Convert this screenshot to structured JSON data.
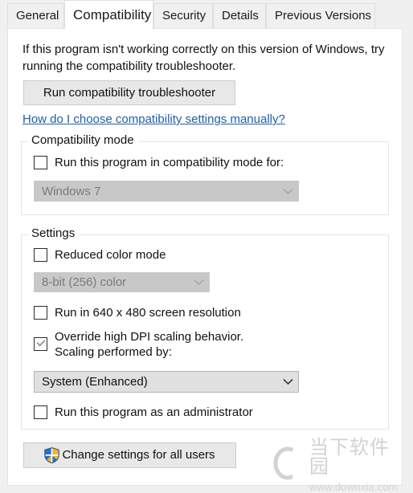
{
  "tabs": [
    {
      "label": "General",
      "selected": false
    },
    {
      "label": "Compatibility",
      "selected": true
    },
    {
      "label": "Security",
      "selected": false
    },
    {
      "label": "Details",
      "selected": false
    },
    {
      "label": "Previous Versions",
      "selected": false
    }
  ],
  "intro": "If this program isn't working correctly on this version of Windows, try running the compatibility troubleshooter.",
  "troubleshoot_button": "Run compatibility troubleshooter",
  "help_link": "How do I choose compatibility settings manually?",
  "compatibility_mode": {
    "title": "Compatibility mode",
    "checkbox_label": "Run this program in compatibility mode for:",
    "checkbox_checked": false,
    "combo_value": "Windows 7",
    "combo_enabled": false
  },
  "settings": {
    "title": "Settings",
    "reduced_color": {
      "label": "Reduced color mode",
      "checked": false
    },
    "color_depth_combo": {
      "value": "8-bit (256) color",
      "enabled": false
    },
    "low_resolution": {
      "label": "Run in 640 x 480 screen resolution",
      "checked": false
    },
    "override_dpi": {
      "label": "Override high DPI scaling behavior.\nScaling performed by:",
      "checked": true
    },
    "dpi_combo": {
      "value": "System (Enhanced)",
      "enabled": true
    },
    "run_as_admin": {
      "label": "Run this program as an administrator",
      "checked": false
    }
  },
  "change_all_users_button": "Change settings for all users",
  "shield_icon_name": "uac-shield-icon",
  "watermark": {
    "cn_text": "当下软件园",
    "url": "www.downxia.com"
  },
  "colors": {
    "link": "#1f5fa9",
    "shield_blue": "#2a6fc4",
    "shield_gold": "#f0b429",
    "disabled_bg": "#c8c8c8",
    "enabled_combo_bg": "#e0e0e0"
  }
}
